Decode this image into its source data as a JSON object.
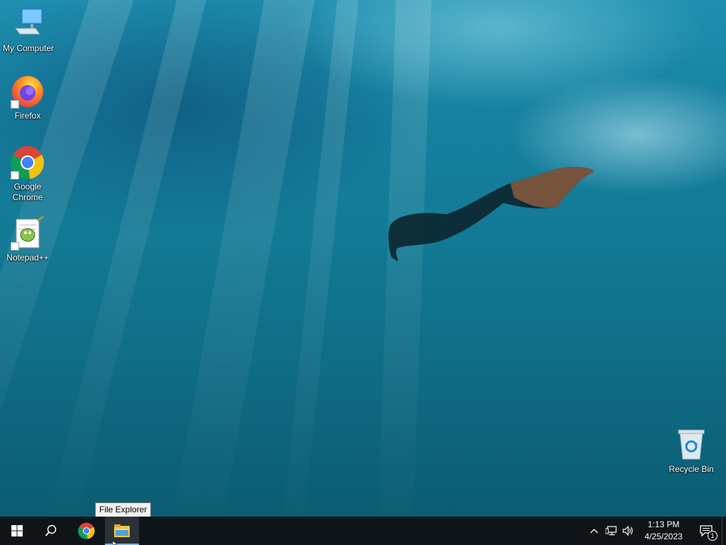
{
  "desktop": {
    "icons": [
      {
        "label": "My Computer",
        "icon": "computer-icon"
      },
      {
        "label": "Firefox",
        "icon": "firefox-icon"
      },
      {
        "label": "Google\nChrome",
        "icon": "chrome-icon"
      },
      {
        "label": "Notepad++",
        "icon": "notepadpp-icon"
      },
      {
        "label": "Recycle Bin",
        "icon": "recycle-bin-icon"
      }
    ]
  },
  "taskbar": {
    "start_icon": "windows-logo-icon",
    "search_icon": "search-icon",
    "pinned": [
      {
        "name": "Google Chrome",
        "icon": "chrome-icon",
        "active": false
      },
      {
        "name": "File Explorer",
        "icon": "folder-icon",
        "active": true
      }
    ],
    "tooltip": "File Explorer",
    "tray": {
      "icons": [
        "chevron-up-icon",
        "network-icon",
        "volume-icon"
      ],
      "time": "1:13 PM",
      "date": "4/25/2023",
      "notification_count": "1"
    }
  },
  "colors": {
    "taskbar_bg": "#0e1418",
    "active_indicator": "#79b8ff",
    "water_top": "#1f8fb0",
    "water_bottom": "#0b5c72"
  }
}
